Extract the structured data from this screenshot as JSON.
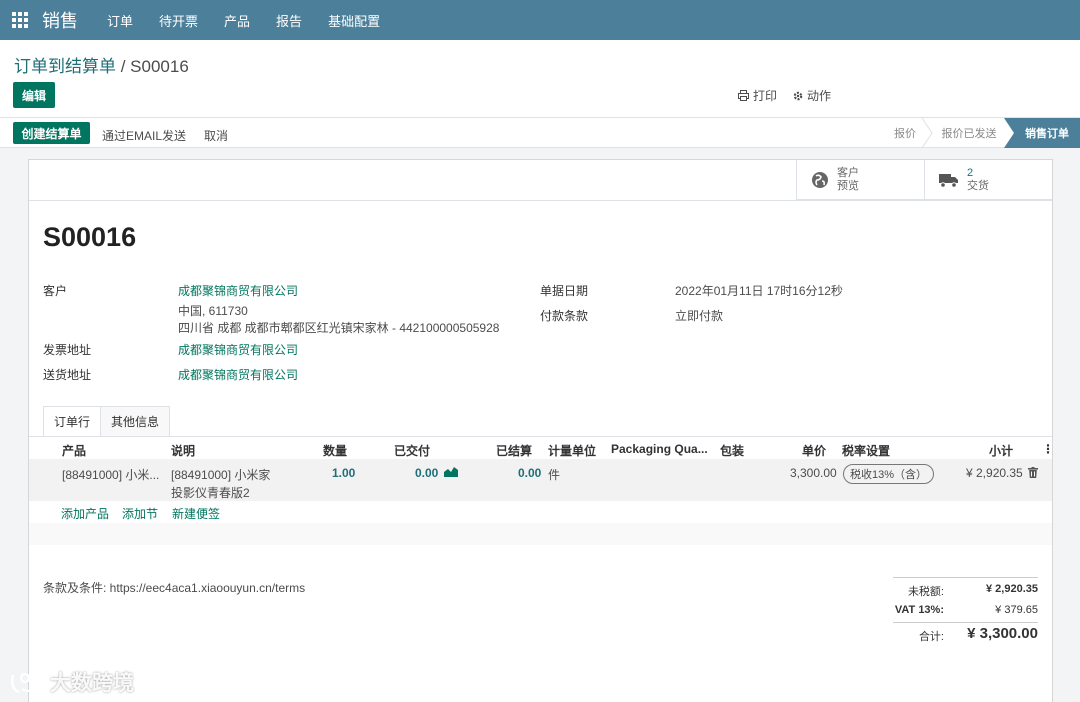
{
  "nav": {
    "brand": "销售",
    "menu": [
      "订单",
      "待开票",
      "产品",
      "报告",
      "基础配置"
    ]
  },
  "breadcrumb": {
    "parent": "订单到结算单",
    "separator": " / ",
    "current": "S00016"
  },
  "buttons": {
    "edit": "编辑",
    "print": "打印",
    "action": "动作"
  },
  "statusbar": {
    "create_invoice": "创建结算单",
    "send_email": "通过EMAIL发送",
    "cancel": "取消",
    "stages": [
      "报价",
      "报价已发送",
      "销售订单"
    ],
    "active_stage": "销售订单"
  },
  "smart_buttons": {
    "customer_preview": {
      "line1": "客户",
      "line2": "预览"
    },
    "delivery": {
      "count": "2",
      "label": "交货"
    }
  },
  "order": {
    "name": "S00016",
    "customer_label": "客户",
    "customer_name": "成都聚锦商贸有限公司",
    "customer_addr1": "中国, 611730",
    "customer_addr2": "四川省 成都 成都市郫都区红光镇宋家林 - 442100000505928",
    "invoice_addr_label": "发票地址",
    "invoice_addr": "成都聚锦商贸有限公司",
    "delivery_addr_label": "送货地址",
    "delivery_addr": "成都聚锦商贸有限公司",
    "date_label": "单据日期",
    "date": "2022年01月11日 17时16分12秒",
    "terms_label": "付款条款",
    "terms": "立即付款"
  },
  "tabs": [
    "订单行",
    "其他信息"
  ],
  "table": {
    "headers": {
      "product": "产品",
      "description": "说明",
      "quantity": "数量",
      "delivered": "已交付",
      "invoiced": "已结算",
      "uom": "计量单位",
      "packaging_qty": "Packaging Qua...",
      "packaging": "包装",
      "unit_price": "单价",
      "taxes": "税率设置",
      "subtotal": "小计"
    },
    "rows": [
      {
        "product": "[88491000] 小米...",
        "description_line1": "[88491000] 小米家",
        "description_line2": "投影仪青春版2",
        "quantity": "1.00",
        "delivered": "0.00",
        "invoiced": "0.00",
        "uom": "件",
        "unit_price": "3,300.00",
        "tax": "税收13%（含）",
        "subtotal": "¥ 2,920.35"
      }
    ],
    "add_product": "添加产品",
    "add_section": "添加节",
    "add_note": "新建便签"
  },
  "terms_text": "条款及条件: https://eec4aca1.xiaoouyun.cn/terms",
  "totals": {
    "untaxed_label": "未税额:",
    "untaxed": "¥ 2,920.35",
    "vat_label": "VAT 13%:",
    "vat": "¥ 379.65",
    "total_label": "合计:",
    "total": "¥ 3,300.00"
  },
  "watermark": "大数跨境",
  "colors": {
    "nav": "#4c7f9a",
    "primary": "#00755f",
    "link": "#1e6f78"
  }
}
